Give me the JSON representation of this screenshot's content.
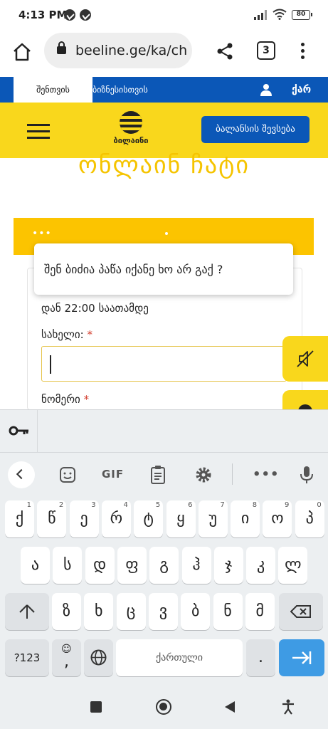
{
  "status_bar": {
    "time": "4:13 PM",
    "battery": "80"
  },
  "browser": {
    "url": "beeline.ge/ka/ch",
    "tab_count": "3"
  },
  "site_nav": {
    "personal_tab": "შენთვის",
    "business_tab": "ბიზნესისთვის",
    "language": "ქარ"
  },
  "header": {
    "logo_text": "ბილაინი",
    "topup_label": "ბალანსის შევსება"
  },
  "page": {
    "heading": "ონლაინ ჩატი"
  },
  "chat": {
    "dots": "•••",
    "hours_text": "დან 22:00 საათამდე",
    "name_label": "სახელი:",
    "required_mark": "*",
    "phone_label": "ნომერი"
  },
  "popup": {
    "text": "შენ ბიძია პაწა იქანე ხო არ გაქ ?"
  },
  "keyboard": {
    "gif_label": "GIF",
    "row1": [
      {
        "label": "ქ",
        "hint": "1"
      },
      {
        "label": "წ",
        "hint": "2"
      },
      {
        "label": "ე",
        "hint": "3"
      },
      {
        "label": "რ",
        "hint": "4"
      },
      {
        "label": "ტ",
        "hint": "5"
      },
      {
        "label": "ყ",
        "hint": "6"
      },
      {
        "label": "უ",
        "hint": "7"
      },
      {
        "label": "ი",
        "hint": "8"
      },
      {
        "label": "ო",
        "hint": "9"
      },
      {
        "label": "პ",
        "hint": "0"
      }
    ],
    "row2": [
      "ა",
      "ს",
      "დ",
      "ფ",
      "გ",
      "ჰ",
      "ჯ",
      "კ",
      "ლ"
    ],
    "row3": [
      "ზ",
      "ხ",
      "ც",
      "ვ",
      "ბ",
      "ნ",
      "მ"
    ],
    "symbols_label": "?123",
    "comma_label": ",",
    "space_label": "ქართული",
    "period_label": "."
  },
  "colors": {
    "brand_yellow": "#f9d71c",
    "brand_blue": "#0b57b7",
    "enter_blue": "#3e9be4"
  }
}
